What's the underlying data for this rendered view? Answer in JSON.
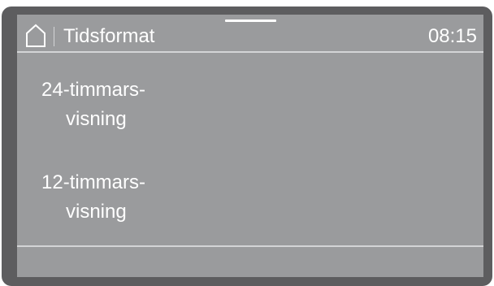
{
  "header": {
    "home_icon": "home-icon",
    "title": "Tidsformat",
    "time": "08:15"
  },
  "options": [
    {
      "line1": "24-timmars-",
      "line2": "visning"
    },
    {
      "line1": "12-timmars-",
      "line2": "visning"
    }
  ],
  "colors": {
    "bezel": "#5d5d5f",
    "screen": "#9a9b9d",
    "text": "#ffffff",
    "divider": "#d3d4d6"
  }
}
